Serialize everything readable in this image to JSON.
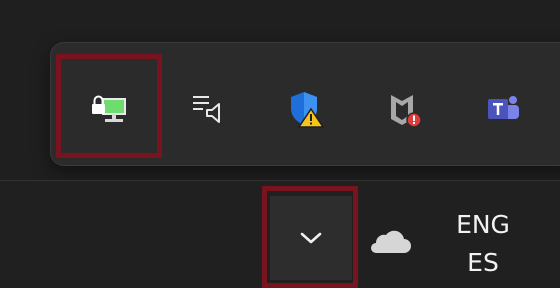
{
  "taskbar": {
    "language": {
      "line1": "ENG",
      "line2": "ES"
    }
  },
  "tray_flyout": {
    "icons": [
      {
        "name": "network-locked-monitor-icon",
        "highlighted": true
      },
      {
        "name": "speaker-playlist-icon"
      },
      {
        "name": "windows-security-warning-icon"
      },
      {
        "name": "mcafee-alert-icon"
      },
      {
        "name": "teams-icon"
      }
    ]
  },
  "chevron": {
    "name": "chevron-up-icon",
    "highlighted": true
  },
  "colors": {
    "highlight": "#7a1320",
    "flyout_bg": "#2b2b2b",
    "taskbar_bg": "#202020",
    "text": "#f2f2f2"
  }
}
